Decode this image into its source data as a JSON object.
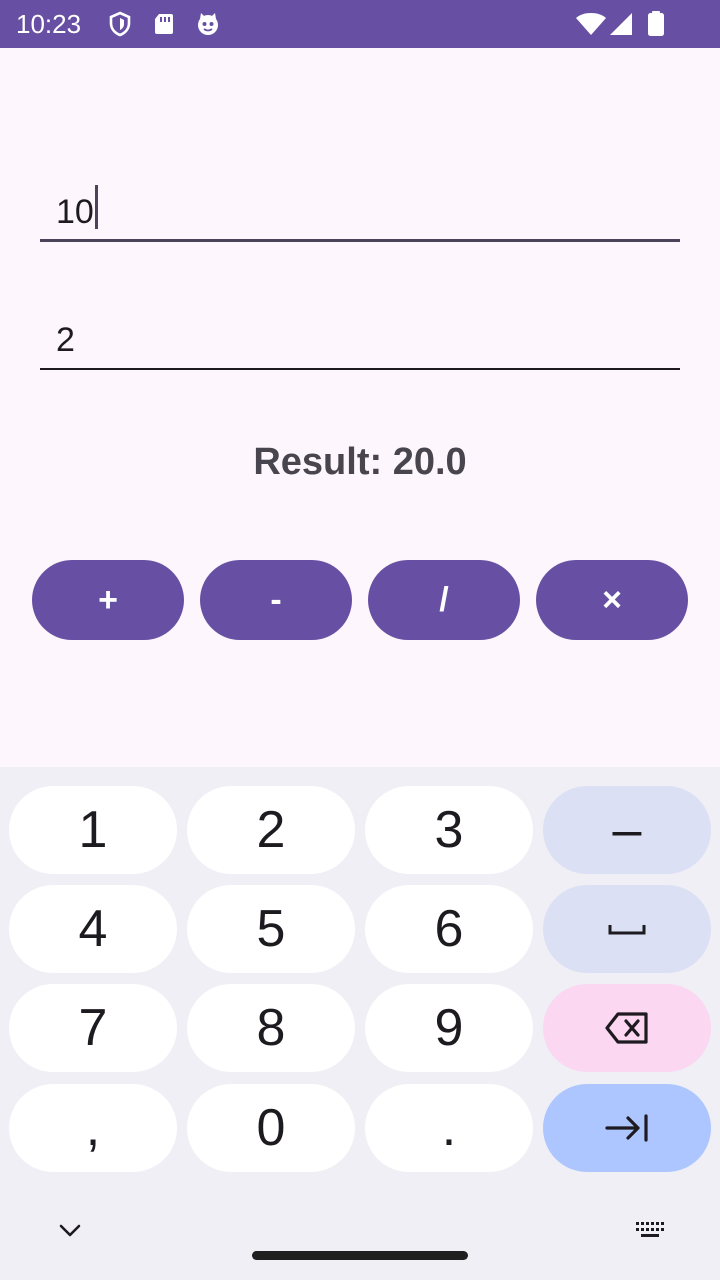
{
  "status_bar": {
    "time": "10:23",
    "icons_left": [
      "shield-icon",
      "sd-card-icon",
      "cat-face-icon"
    ],
    "icons_right": [
      "wifi-icon",
      "cell-signal-icon",
      "battery-icon"
    ],
    "background": "#6750a4"
  },
  "form": {
    "first_number": "10",
    "second_number": "2",
    "result": "Result: 20.0"
  },
  "operations": [
    "+",
    "-",
    "/",
    "×"
  ],
  "keyboard": {
    "rows": [
      [
        "1",
        "2",
        "3",
        "–"
      ],
      [
        "4",
        "5",
        "6",
        "space-icon"
      ],
      [
        "7",
        "8",
        "9",
        "backspace-icon"
      ],
      [
        ",",
        "0",
        ".",
        "tab-icon"
      ]
    ],
    "bottom_left_icon": "chevron-down-icon",
    "bottom_right_icon": "keyboard-icon"
  },
  "colors": {
    "accent": "#6750a4",
    "background": "#fdf7fd",
    "keyboard_background": "#f0eff5",
    "key": "#ffffff",
    "symbol_key": "#dce0f4",
    "delete_key": "#fbd7f2",
    "tab_key": "#adc6ff"
  }
}
